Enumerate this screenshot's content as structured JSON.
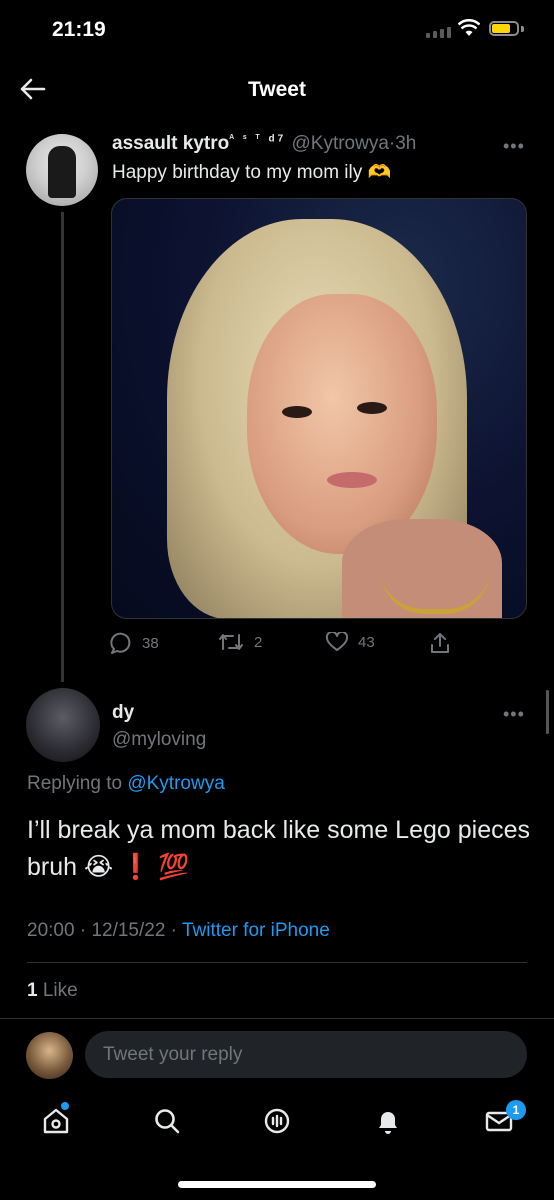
{
  "status": {
    "time": "21:19",
    "battery_color": "#ffd60a"
  },
  "header": {
    "title": "Tweet"
  },
  "tweet": {
    "name": "assault kytro",
    "name_superscript": "ᴬ ˢ ᵀ d7",
    "handle": "@Kytrowya",
    "separator": "·",
    "age": "3h",
    "text": "Happy birthday to my mom ily 🫶",
    "more": "•••",
    "replies": "38",
    "retweets": "2",
    "likes": "43"
  },
  "reply": {
    "name": "dy",
    "handle": "@myloving",
    "more": "•••",
    "replying_prefix": "Replying to ",
    "replying_handle": "@Kytrowya",
    "text": "I’ll break ya mom back like some Lego pieces bruh 😭 ❗ 💯",
    "time": "20:00",
    "date": "12/15/22",
    "meta_sep": " · ",
    "source": "Twitter for iPhone",
    "like_count": "1",
    "like_label": " Like"
  },
  "composer": {
    "placeholder": "Tweet your reply"
  },
  "tabbar": {
    "notification_badge": "1",
    "accent": "#1d9bf0"
  }
}
